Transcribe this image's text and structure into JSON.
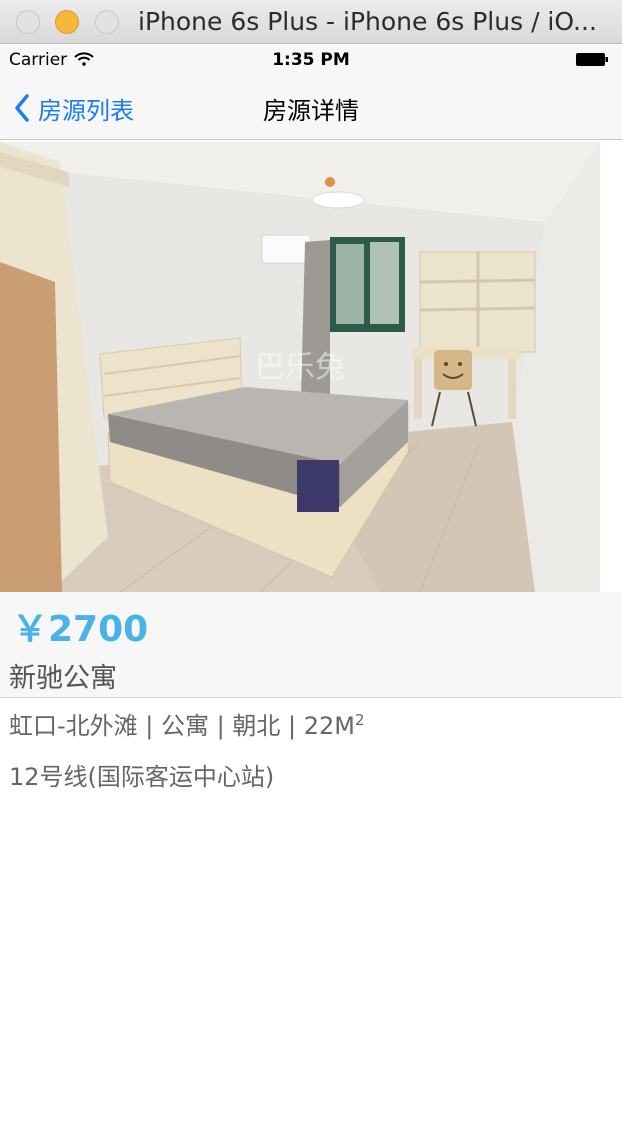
{
  "window": {
    "title": "iPhone 6s Plus - iPhone 6s Plus / iO..."
  },
  "status_bar": {
    "carrier": "Carrier",
    "time": "1:35 PM"
  },
  "nav": {
    "back_label": "房源列表",
    "title": "房源详情"
  },
  "photo": {
    "watermark": "巴乐兔"
  },
  "house": {
    "price": "￥2700",
    "name": "新驰公寓",
    "details": "虹口-北外滩 | 公寓 | 朝北 | 22M",
    "area_superscript": "2",
    "subway": "12号线(国际客运中心站)"
  },
  "colors": {
    "accent_blue": "#1a7cf2",
    "price_blue": "#4ab3e6"
  }
}
